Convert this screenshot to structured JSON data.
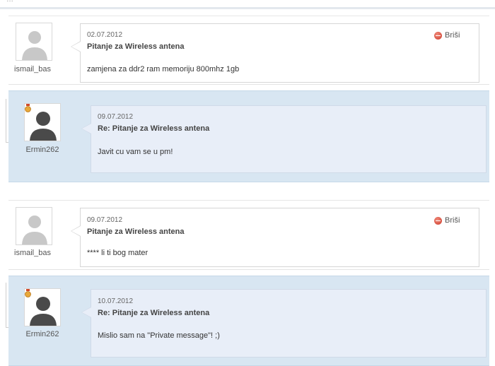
{
  "header": {
    "partial_text": "…"
  },
  "messages": [
    {
      "type": "sent",
      "username": "ismail_bas",
      "date": "02.07.2012",
      "subject": "Pitanje za Wireless antena",
      "body": "zamjena za ddr2 ram memoriju 800mhz 1gb",
      "delete_label": "Briši"
    },
    {
      "type": "reply",
      "username": "Ermin262",
      "date": "09.07.2012",
      "subject": "Re: Pitanje za Wireless antena",
      "body": "Javit cu vam se u pm!"
    },
    {
      "type": "sent",
      "username": "ismail_bas",
      "date": "09.07.2012",
      "subject": "Pitanje za Wireless antena",
      "body": "**** li ti bog mater",
      "delete_label": "Briši"
    },
    {
      "type": "reply",
      "username": "Ermin262",
      "date": "10.07.2012",
      "subject": "Re: Pitanje za Wireless antena",
      "body": "Mislio sam na \"Private message\"! ;)"
    }
  ],
  "colors": {
    "reply_background": "#d8e6f2",
    "reply_bubble": "#e8eef8",
    "delete_icon": "#cc3a2a"
  },
  "icons": {
    "avatar": "default-user-silhouette-icon",
    "badge": "user-rank-badge-icon",
    "delete": "minus-circle-icon"
  }
}
